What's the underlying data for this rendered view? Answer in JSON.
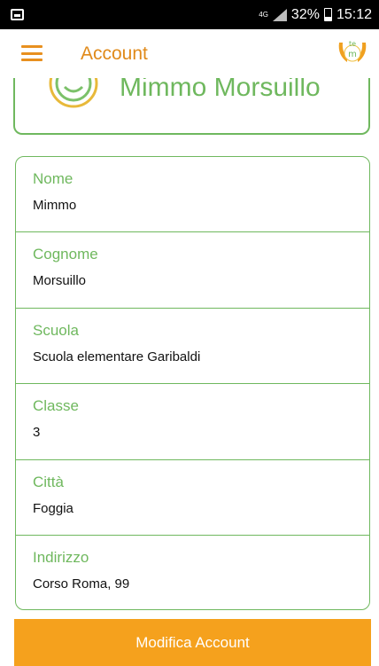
{
  "status_bar": {
    "network": "4G",
    "battery": "32%",
    "time": "15:12"
  },
  "app_bar": {
    "title": "Account",
    "logo_text_top": "te",
    "logo_text_bottom": "m"
  },
  "profile": {
    "name": "Mimmo Morsuillo"
  },
  "fields": [
    {
      "label": "Nome",
      "value": "Mimmo"
    },
    {
      "label": "Cognome",
      "value": "Morsuillo"
    },
    {
      "label": "Scuola",
      "value": "Scuola elementare Garibaldi"
    },
    {
      "label": "Classe",
      "value": "3"
    },
    {
      "label": "Città",
      "value": "Foggia"
    },
    {
      "label": "Indirizzo",
      "value": "Corso Roma, 99"
    }
  ],
  "action": {
    "label": "Modifica Account"
  },
  "colors": {
    "accent_orange": "#f5a11d",
    "title_orange": "#e08a1a",
    "green": "#6fb85e"
  }
}
